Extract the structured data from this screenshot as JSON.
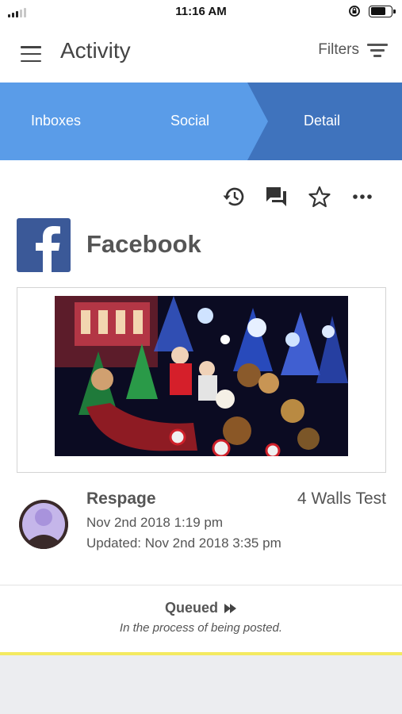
{
  "status_bar": {
    "time": "11:16 AM",
    "signal_icon": "cellular-signal-icon",
    "lock_icon": "rotation-lock-icon",
    "battery_icon": "battery-icon"
  },
  "header": {
    "title": "Activity",
    "filters_label": "Filters",
    "menu_icon": "hamburger-menu-icon",
    "filter_icon": "filter-lines-icon"
  },
  "breadcrumb": {
    "items": [
      {
        "label": "Inboxes"
      },
      {
        "label": "Social"
      },
      {
        "label": "Detail"
      }
    ],
    "colors": {
      "light": "#5a9ce8",
      "dark": "#3f73bd"
    }
  },
  "actions": {
    "icons": [
      "history-icon",
      "chat-bubbles-icon",
      "star-outline-icon",
      "more-horizontal-icon"
    ]
  },
  "post": {
    "network": "Facebook",
    "network_icon": "facebook-logo-icon",
    "network_color": "#3b5998",
    "image_icon": "christmas-lights-photo",
    "author": "Respage",
    "account": "4 Walls Test",
    "date": "Nov 2nd 2018 1:19 pm",
    "updated": "Updated: Nov 2nd 2018 3:35 pm",
    "avatar_icon": "user-avatar-icon"
  },
  "status": {
    "label": "Queued",
    "icon": "fast-forward-icon",
    "description": "In the process of being posted.",
    "accent_color": "#f4ea60"
  }
}
